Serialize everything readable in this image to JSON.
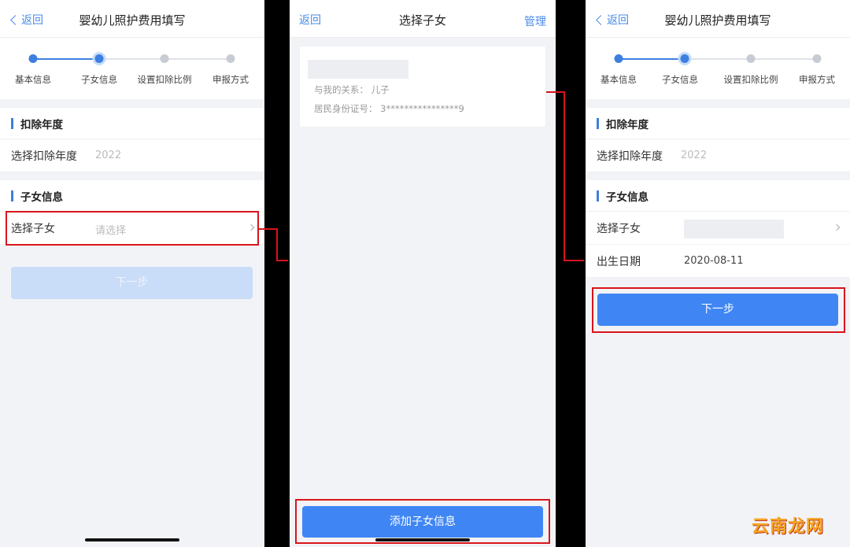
{
  "screen1": {
    "back": "返回",
    "title": "婴幼儿照护费用填写",
    "steps": [
      "基本信息",
      "子女信息",
      "设置扣除比例",
      "申报方式"
    ],
    "section_year": "扣除年度",
    "year_label": "选择扣除年度",
    "year_value": "2022",
    "section_child": "子女信息",
    "child_label": "选择子女",
    "child_placeholder": "请选择",
    "next": "下一步"
  },
  "screen2": {
    "back": "返回",
    "title": "选择子女",
    "manage": "管理",
    "relation": "与我的关系：   儿子",
    "id_number": "居民身份证号：  3****************9",
    "add": "添加子女信息"
  },
  "screen3": {
    "back": "返回",
    "title": "婴幼儿照护费用填写",
    "steps": [
      "基本信息",
      "子女信息",
      "设置扣除比例",
      "申报方式"
    ],
    "section_year": "扣除年度",
    "year_label": "选择扣除年度",
    "year_value": "2022",
    "section_child": "子女信息",
    "child_label": "选择子女",
    "birth_label": "出生日期",
    "birth_value": "2020-08-11",
    "next": "下一步"
  },
  "watermark": "云南龙网",
  "colors": {
    "accent": "#3d7fe0",
    "button": "#3f86f4",
    "button_disabled": "#c9dcf8",
    "highlight": "#d9141b",
    "background": "#f2f3f7"
  }
}
